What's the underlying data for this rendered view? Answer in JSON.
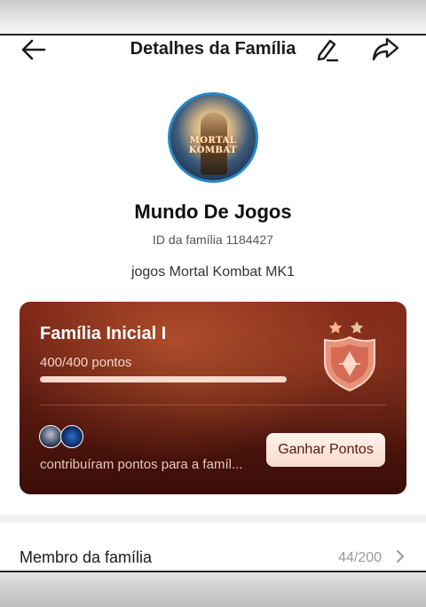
{
  "header": {
    "title": "Detalhes da Família",
    "back_icon": "arrow-left-icon",
    "edit_icon": "pencil-icon",
    "share_icon": "share-arrow-icon"
  },
  "family": {
    "avatar_text": "MORTAL KOMBAT",
    "name": "Mundo De Jogos",
    "id_label": "ID da família 1184427",
    "description": "jogos Mortal Kombat MK1"
  },
  "level_card": {
    "level_name": "Família Inicial I",
    "points_text": "400/400 pontos",
    "progress_fraction": 1.0,
    "contributors_text": "contribuíram pontos para a famíl...",
    "earn_button_label": "Ganhar Pontos",
    "badge_icon": "shield-badge-icon",
    "badge_stars": 2
  },
  "members": {
    "label": "Membro da família",
    "count": "44/200"
  }
}
